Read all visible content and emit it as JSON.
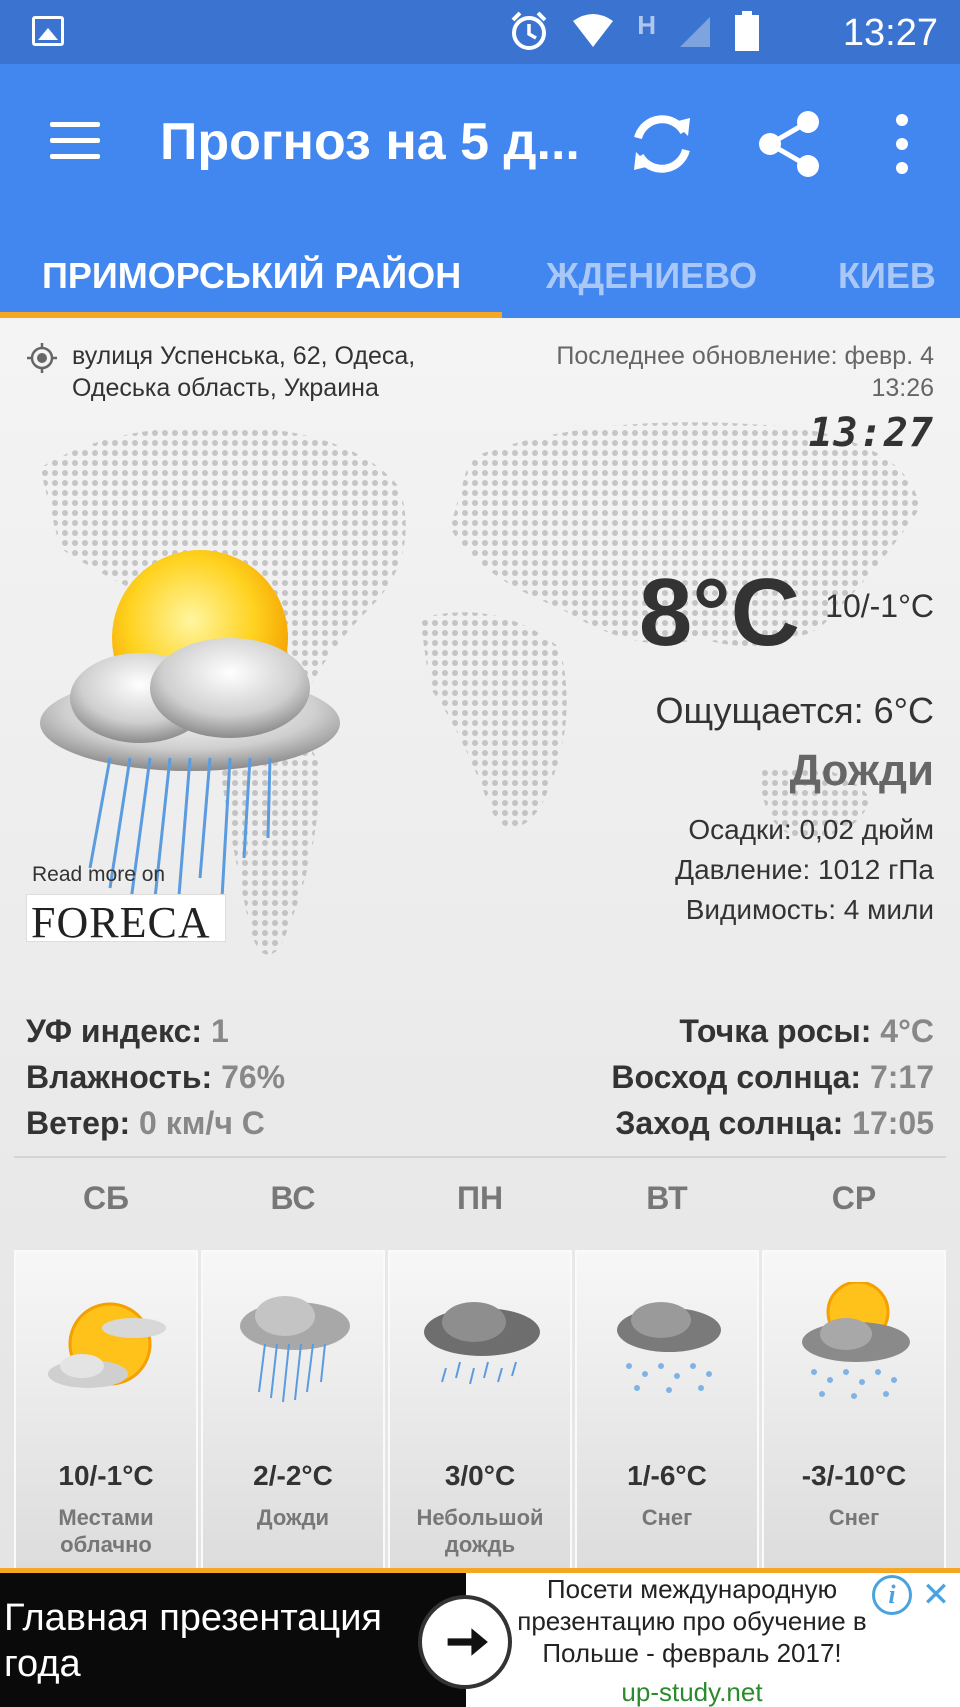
{
  "status_bar": {
    "time": "13:27",
    "network_label": "H",
    "icons": [
      "gallery-icon",
      "alarm-icon",
      "wifi-icon",
      "signal-icon",
      "battery-icon"
    ]
  },
  "app_bar": {
    "title": "Прогноз на 5 д...",
    "actions": [
      "menu-icon",
      "refresh-icon",
      "share-icon",
      "more-vert-icon"
    ]
  },
  "tabs": [
    {
      "label": "ПРИМОРСЬКИЙ РАЙОН",
      "active": true
    },
    {
      "label": "ЖДЕНИЕВО",
      "active": false
    },
    {
      "label": "КИЕВ",
      "active": false
    }
  ],
  "location": {
    "address_line1": "вулиця Успенська, 62, Одеса,",
    "address_line2": "Одеська область, Украина",
    "update_line1": "Последнее обновление: февр. 4",
    "update_line2": "13:26",
    "clock": "13:27"
  },
  "current": {
    "temp": "8°C",
    "range": "10/-1°C",
    "feels_like": "Ощущается: 6°C",
    "condition": "Дожди",
    "precip": "Осадки: 0,02 дюйм",
    "pressure": "Давление: 1012 гПа",
    "visibility": "Видимость: 4 мили",
    "read_more": "Read more on",
    "provider": "FORECA"
  },
  "stats": {
    "uv_label": "УФ индекс:",
    "uv_value": "1",
    "humidity_label": "Влажность:",
    "humidity_value": "76%",
    "wind_label": "Ветер:",
    "wind_value": "0 км/ч С",
    "dew_label": "Точка росы:",
    "dew_value": "4°C",
    "sunrise_label": "Восход солнца:",
    "sunrise_value": "7:17",
    "sunset_label": "Заход солнца:",
    "sunset_value": "17:05"
  },
  "forecast": [
    {
      "day": "СБ",
      "temp": "10/-1°C",
      "desc1": "Местами",
      "desc2": "облачно",
      "icon": "partly-cloudy-icon"
    },
    {
      "day": "ВС",
      "temp": "2/-2°C",
      "desc1": "Дожди",
      "desc2": "",
      "icon": "rain-icon"
    },
    {
      "day": "ПН",
      "temp": "3/0°C",
      "desc1": "Небольшой",
      "desc2": "дождь",
      "icon": "light-rain-icon"
    },
    {
      "day": "ВТ",
      "temp": "1/-6°C",
      "desc1": "Снег",
      "desc2": "",
      "icon": "snow-icon"
    },
    {
      "day": "СР",
      "temp": "-3/-10°C",
      "desc1": "Снег",
      "desc2": "",
      "icon": "sun-snow-icon"
    }
  ],
  "ad": {
    "left_line1": "Главная презентация",
    "left_line2": "года",
    "right_line1": "Посети международную",
    "right_line2": "презентацию про обучение в",
    "right_line3": "Польше - февраль 2017!",
    "url": "up-study.net",
    "info": "i",
    "close": "✕"
  },
  "colors": {
    "status_bar": "#3a73d0",
    "app_bar": "#4286f0",
    "tab_indicator": "#f5a623",
    "rain": "#5b9be0"
  }
}
